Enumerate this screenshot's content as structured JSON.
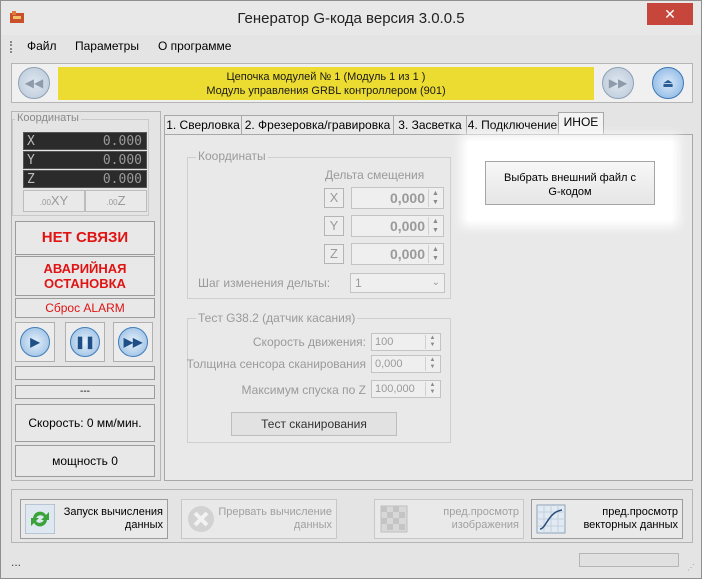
{
  "window": {
    "title": "Генератор G-кода версия 3.0.0.5",
    "close_label": "✕"
  },
  "menu": {
    "items": [
      "Файл",
      "Параметры",
      "О программе"
    ]
  },
  "module": {
    "line1": "Цепочка модулей № 1 (Модуль 1 из 1 )",
    "line2": "Модуль управления GRBL контроллером (901)",
    "prev_icon": "rewind-icon",
    "next_icon": "fast-forward-icon",
    "eject_icon": "eject-icon"
  },
  "left": {
    "coords_caption": "Координаты",
    "coords": [
      {
        "axis": "X",
        "value": "0.000"
      },
      {
        "axis": "Y",
        "value": "0.000"
      },
      {
        "axis": "Z",
        "value": "0.000"
      }
    ],
    "zero_xy": "XY",
    "zero_z": "Z",
    "zero_prefix": ".00",
    "no_connection": "НЕТ СВЯЗИ",
    "emergency_line1": "АВАРИЙНАЯ",
    "emergency_line2": "ОСТАНОВКА",
    "reset_alarm": "Сброс ALARM",
    "dashes": "---",
    "speed": "Скорость: 0 мм/мин.",
    "power": "мощность 0"
  },
  "tabs": [
    "1. Сверловка",
    "2. Фрезеровка/гравировка",
    "3. Засветка",
    "4. Подключение",
    "ИНОЕ"
  ],
  "coords_group": {
    "caption": "Координаты",
    "delta_label": "Дельта смещения",
    "rows": [
      {
        "axis": "X",
        "value": "0,000"
      },
      {
        "axis": "Y",
        "value": "0,000"
      },
      {
        "axis": "Z",
        "value": "0,000"
      }
    ],
    "step_label": "Шаг изменения дельты:",
    "step_value": "1"
  },
  "test_group": {
    "caption": "Тест G38.2 (датчик касания)",
    "speed_label": "Скорость движения:",
    "speed_value": "100",
    "thickness_label": "Толщина сенсора сканирования",
    "thickness_value": "0,000",
    "descent_label": "Максимум спуска по Z",
    "descent_value": "100,000",
    "scan_button": "Тест сканирования"
  },
  "external_file_button": {
    "line1": "Выбрать внешний файл с",
    "line2": "G-кодом"
  },
  "bottom": {
    "start_calc": {
      "line1": "Запуск вычисления",
      "line2": "данных"
    },
    "stop_calc": {
      "line1": "Прервать вычисление",
      "line2": "данных"
    },
    "preview_image": {
      "line1": "пред.просмотр",
      "line2": "изображения"
    },
    "preview_vector": {
      "line1": "пред.просмотр",
      "line2": "векторных данных"
    }
  },
  "status": {
    "text": "..."
  },
  "colors": {
    "module_yellow": "#ecdc32",
    "alarm_red": "#e01414",
    "close_red": "#c7463c"
  }
}
